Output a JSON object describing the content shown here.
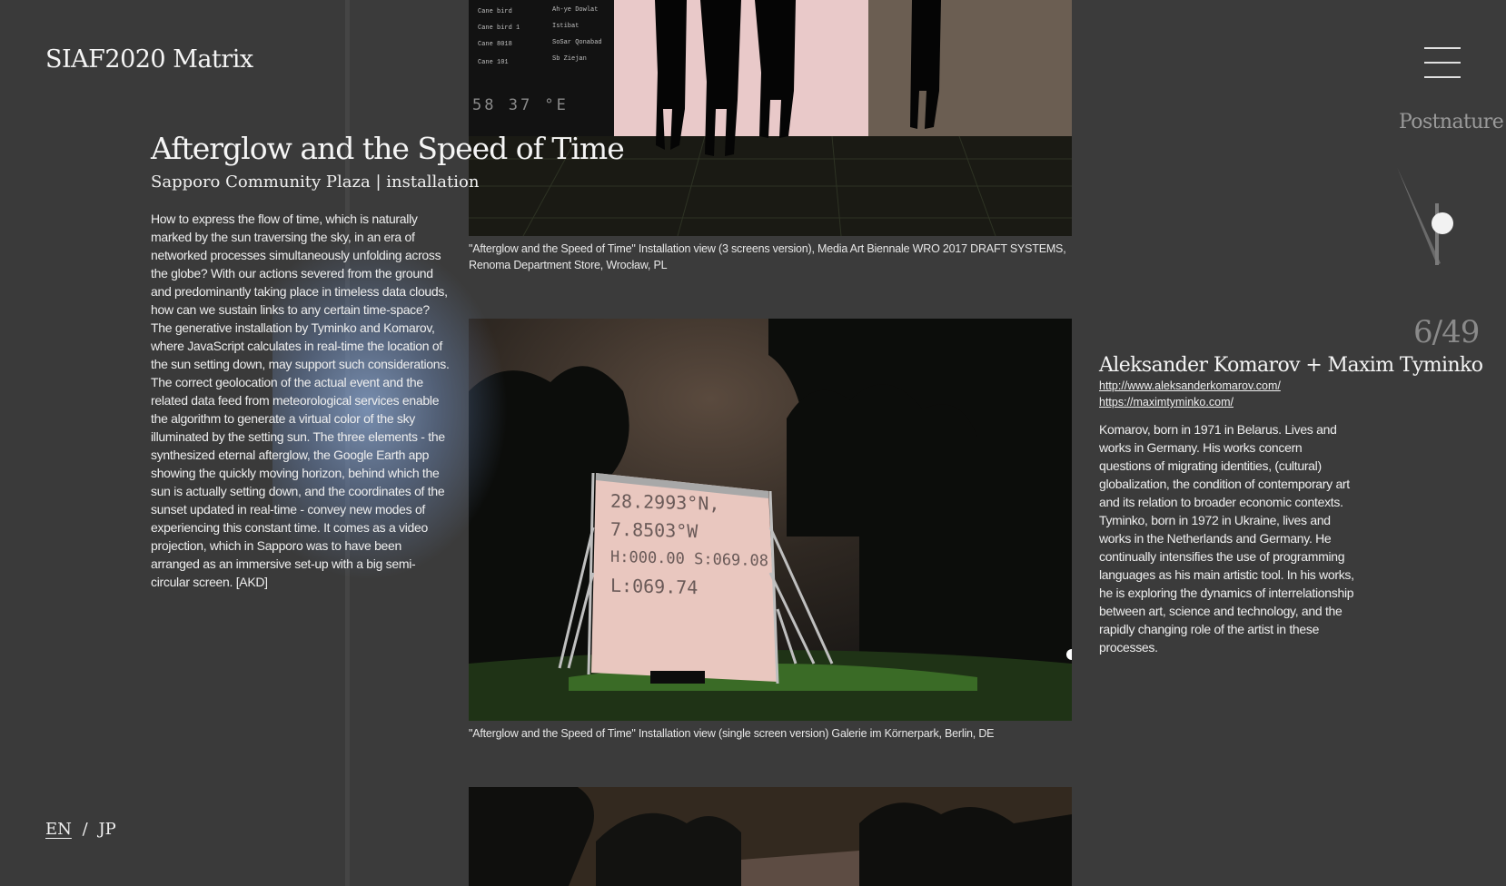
{
  "site": {
    "logo": "SIAF2020 Matrix"
  },
  "work": {
    "title": "Afterglow and the Speed of Time",
    "subtitle": "Sapporo Community Plaza | installation",
    "description": "How to express the flow of time, which is naturally marked by the sun traversing the sky, in an era of networked processes simultaneously unfolding across the globe? With our actions severed from the ground and predominantly taking place in timeless data clouds, how can we sustain links to any certain time-space? The generative installation by Tyminko and Komarov, where JavaScript calculates in real-time the location of the sun setting down, may support such considerations. The correct geolocation of the actual event and the related data feed from meteorological services enable the algorithm to generate a virtual color of the sky illuminated by the setting sun. The three elements - the synthesized eternal afterglow, the Google Earth app showing the quickly moving horizon, behind which the sun is actually setting down, and the coordinates of the sunset updated in real-time - convey new modes of experiencing this constant time. It comes as a video projection, which in Sapporo was to have been arranged as an immersive set-up with a big semi-circular screen. [AKD]"
  },
  "photos": [
    {
      "caption": "\"Afterglow and the Speed of Time\" Installation view (3 screens version), Media Art Biennale WRO 2017 DRAFT SYSTEMS, Renoma Department Store, Wrocław, PL",
      "overlay_text": "58  37  °E"
    },
    {
      "caption": "\"Afterglow and the Speed of Time\" Installation view (single screen version) Galerie im Körnerpark, Berlin, DE",
      "screen_lines": [
        "28.2993°N,",
        "7.8503°W",
        "H:000.00 S:069.08",
        "L:069.74"
      ]
    },
    {
      "caption": ""
    }
  ],
  "artist": {
    "name": "Aleksander Komarov + Maxim Tyminko",
    "links": [
      "http://www.aleksanderkomarov.com/",
      "https://maximtyminko.com/"
    ],
    "bio": [
      "Komarov, born in 1971 in Belarus. Lives and works in Germany. His works concern questions of migrating identities, (cultural) globalization, the condition of contemporary art and its relation to broader economic contexts.",
      "Tyminko, born in 1972 in Ukraine, lives and works in the Netherlands and Germany. He continually intensifies the use of programming languages as his main artistic tool. In his works, he is exploring the dynamics of interrelationship between art, science and technology, and the rapidly changing role of the artist in these processes."
    ]
  },
  "nav": {
    "section": "Postnature",
    "counter": "6/49",
    "menu_icon": "hamburger-menu-icon"
  },
  "lang": {
    "en": "EN",
    "separator": "/",
    "jp": "JP"
  },
  "colors": {
    "background": "#3b3b3b",
    "text": "#f2f2f2",
    "muted": "#8a8a8a",
    "glow": "#8caad7"
  }
}
